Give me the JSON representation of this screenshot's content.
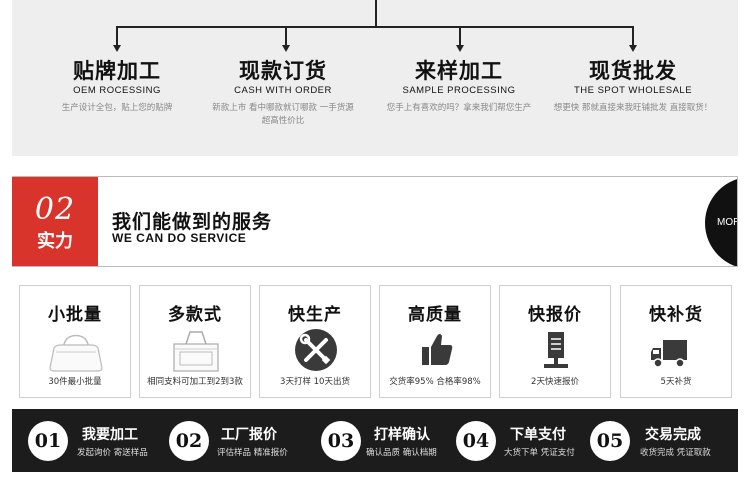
{
  "services": [
    {
      "title": "贴牌加工",
      "subtitle": "OEM ROCESSING",
      "desc": "生产设计全包，贴上您的贴牌"
    },
    {
      "title": "现款订货",
      "subtitle": "CASH WITH ORDER",
      "desc": "新款上市 看中哪款就订哪款 一手货源 超高性价比"
    },
    {
      "title": "来样加工",
      "subtitle": "SAMPLE PROCESSING",
      "desc": "您手上有喜欢的吗？拿来我们帮您生产"
    },
    {
      "title": "现货批发",
      "subtitle": "THE SPOT WHOLESALE",
      "desc": "想更快 那就直接来我旺铺批发 直接取货！"
    }
  ],
  "banner": {
    "number": "02",
    "word": "实力",
    "title": "我们能做到的服务",
    "subtitle": "WE CAN DO SERVICE",
    "more": "MORE>"
  },
  "capabilities": [
    {
      "title": "小批量",
      "desc": "30件最小批量",
      "icon": "handbag-outline-icon"
    },
    {
      "title": "多款式",
      "desc": "相同支料可加工到2到3款",
      "icon": "tote-bag-outline-icon"
    },
    {
      "title": "快生产",
      "desc": "3天打样 10天出货",
      "icon": "tools-icon"
    },
    {
      "title": "高质量",
      "desc": "交货率95% 合格率98%",
      "icon": "thumbs-up-icon"
    },
    {
      "title": "快报价",
      "desc": "2天快速报价",
      "icon": "document-stand-icon"
    },
    {
      "title": "快补货",
      "desc": "5天补货",
      "icon": "truck-icon"
    }
  ],
  "process": [
    {
      "num": "01",
      "title": "我要加工",
      "desc": "发起询价 寄送样品"
    },
    {
      "num": "02",
      "title": "工厂报价",
      "desc": "评估样品 精准报价"
    },
    {
      "num": "03",
      "title": "打样确认",
      "desc": "确认品质 确认档期"
    },
    {
      "num": "04",
      "title": "下单支付",
      "desc": "大货下单 凭证支付"
    },
    {
      "num": "05",
      "title": "交易完成",
      "desc": "收货完成 凭证取款"
    }
  ],
  "colors": {
    "accent": "#d9342b",
    "dark": "#1c1c1c",
    "panel": "#eeeeee"
  }
}
